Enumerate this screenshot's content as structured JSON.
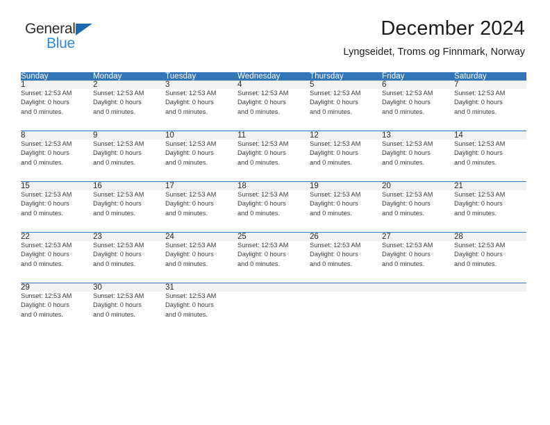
{
  "logo": {
    "word_one": "General",
    "word_two": "Blue",
    "triangle_icon": "triangle-icon",
    "color_dark": "#2b2b2b",
    "color_blue": "#2e8bd8",
    "triangle_color": "#1b69b0"
  },
  "header": {
    "title": "December 2024",
    "subtitle": "Lyngseidet, Troms og Finnmark, Norway"
  },
  "theme": {
    "header_blue": "#3275b8",
    "daynum_band": "#f1f1f1",
    "text": "#3a3a3a"
  },
  "calendar": {
    "day_names": [
      "Sunday",
      "Monday",
      "Tuesday",
      "Wednesday",
      "Thursday",
      "Friday",
      "Saturday"
    ],
    "weeks": [
      {
        "daynums": [
          "1",
          "2",
          "3",
          "4",
          "5",
          "6",
          "7"
        ],
        "cells": [
          {
            "sunset": "Sunset: 12:53 AM",
            "daylight": "Daylight: 0 hours",
            "minutes": "and 0 minutes."
          },
          {
            "sunset": "Sunset: 12:53 AM",
            "daylight": "Daylight: 0 hours",
            "minutes": "and 0 minutes."
          },
          {
            "sunset": "Sunset: 12:53 AM",
            "daylight": "Daylight: 0 hours",
            "minutes": "and 0 minutes."
          },
          {
            "sunset": "Sunset: 12:53 AM",
            "daylight": "Daylight: 0 hours",
            "minutes": "and 0 minutes."
          },
          {
            "sunset": "Sunset: 12:53 AM",
            "daylight": "Daylight: 0 hours",
            "minutes": "and 0 minutes."
          },
          {
            "sunset": "Sunset: 12:53 AM",
            "daylight": "Daylight: 0 hours",
            "minutes": "and 0 minutes."
          },
          {
            "sunset": "Sunset: 12:53 AM",
            "daylight": "Daylight: 0 hours",
            "minutes": "and 0 minutes."
          }
        ]
      },
      {
        "daynums": [
          "8",
          "9",
          "10",
          "11",
          "12",
          "13",
          "14"
        ],
        "cells": [
          {
            "sunset": "Sunset: 12:53 AM",
            "daylight": "Daylight: 0 hours",
            "minutes": "and 0 minutes."
          },
          {
            "sunset": "Sunset: 12:53 AM",
            "daylight": "Daylight: 0 hours",
            "minutes": "and 0 minutes."
          },
          {
            "sunset": "Sunset: 12:53 AM",
            "daylight": "Daylight: 0 hours",
            "minutes": "and 0 minutes."
          },
          {
            "sunset": "Sunset: 12:53 AM",
            "daylight": "Daylight: 0 hours",
            "minutes": "and 0 minutes."
          },
          {
            "sunset": "Sunset: 12:53 AM",
            "daylight": "Daylight: 0 hours",
            "minutes": "and 0 minutes."
          },
          {
            "sunset": "Sunset: 12:53 AM",
            "daylight": "Daylight: 0 hours",
            "minutes": "and 0 minutes."
          },
          {
            "sunset": "Sunset: 12:53 AM",
            "daylight": "Daylight: 0 hours",
            "minutes": "and 0 minutes."
          }
        ]
      },
      {
        "daynums": [
          "15",
          "16",
          "17",
          "18",
          "19",
          "20",
          "21"
        ],
        "cells": [
          {
            "sunset": "Sunset: 12:53 AM",
            "daylight": "Daylight: 0 hours",
            "minutes": "and 0 minutes."
          },
          {
            "sunset": "Sunset: 12:53 AM",
            "daylight": "Daylight: 0 hours",
            "minutes": "and 0 minutes."
          },
          {
            "sunset": "Sunset: 12:53 AM",
            "daylight": "Daylight: 0 hours",
            "minutes": "and 0 minutes."
          },
          {
            "sunset": "Sunset: 12:53 AM",
            "daylight": "Daylight: 0 hours",
            "minutes": "and 0 minutes."
          },
          {
            "sunset": "Sunset: 12:53 AM",
            "daylight": "Daylight: 0 hours",
            "minutes": "and 0 minutes."
          },
          {
            "sunset": "Sunset: 12:53 AM",
            "daylight": "Daylight: 0 hours",
            "minutes": "and 0 minutes."
          },
          {
            "sunset": "Sunset: 12:53 AM",
            "daylight": "Daylight: 0 hours",
            "minutes": "and 0 minutes."
          }
        ]
      },
      {
        "daynums": [
          "22",
          "23",
          "24",
          "25",
          "26",
          "27",
          "28"
        ],
        "cells": [
          {
            "sunset": "Sunset: 12:53 AM",
            "daylight": "Daylight: 0 hours",
            "minutes": "and 0 minutes."
          },
          {
            "sunset": "Sunset: 12:53 AM",
            "daylight": "Daylight: 0 hours",
            "minutes": "and 0 minutes."
          },
          {
            "sunset": "Sunset: 12:53 AM",
            "daylight": "Daylight: 0 hours",
            "minutes": "and 0 minutes."
          },
          {
            "sunset": "Sunset: 12:53 AM",
            "daylight": "Daylight: 0 hours",
            "minutes": "and 0 minutes."
          },
          {
            "sunset": "Sunset: 12:53 AM",
            "daylight": "Daylight: 0 hours",
            "minutes": "and 0 minutes."
          },
          {
            "sunset": "Sunset: 12:53 AM",
            "daylight": "Daylight: 0 hours",
            "minutes": "and 0 minutes."
          },
          {
            "sunset": "Sunset: 12:53 AM",
            "daylight": "Daylight: 0 hours",
            "minutes": "and 0 minutes."
          }
        ]
      },
      {
        "daynums": [
          "29",
          "30",
          "31",
          "",
          "",
          "",
          ""
        ],
        "cells": [
          {
            "sunset": "Sunset: 12:53 AM",
            "daylight": "Daylight: 0 hours",
            "minutes": "and 0 minutes."
          },
          {
            "sunset": "Sunset: 12:53 AM",
            "daylight": "Daylight: 0 hours",
            "minutes": "and 0 minutes."
          },
          {
            "sunset": "Sunset: 12:53 AM",
            "daylight": "Daylight: 0 hours",
            "minutes": "and 0 minutes."
          },
          {
            "sunset": "",
            "daylight": "",
            "minutes": ""
          },
          {
            "sunset": "",
            "daylight": "",
            "minutes": ""
          },
          {
            "sunset": "",
            "daylight": "",
            "minutes": ""
          },
          {
            "sunset": "",
            "daylight": "",
            "minutes": ""
          }
        ]
      }
    ]
  }
}
